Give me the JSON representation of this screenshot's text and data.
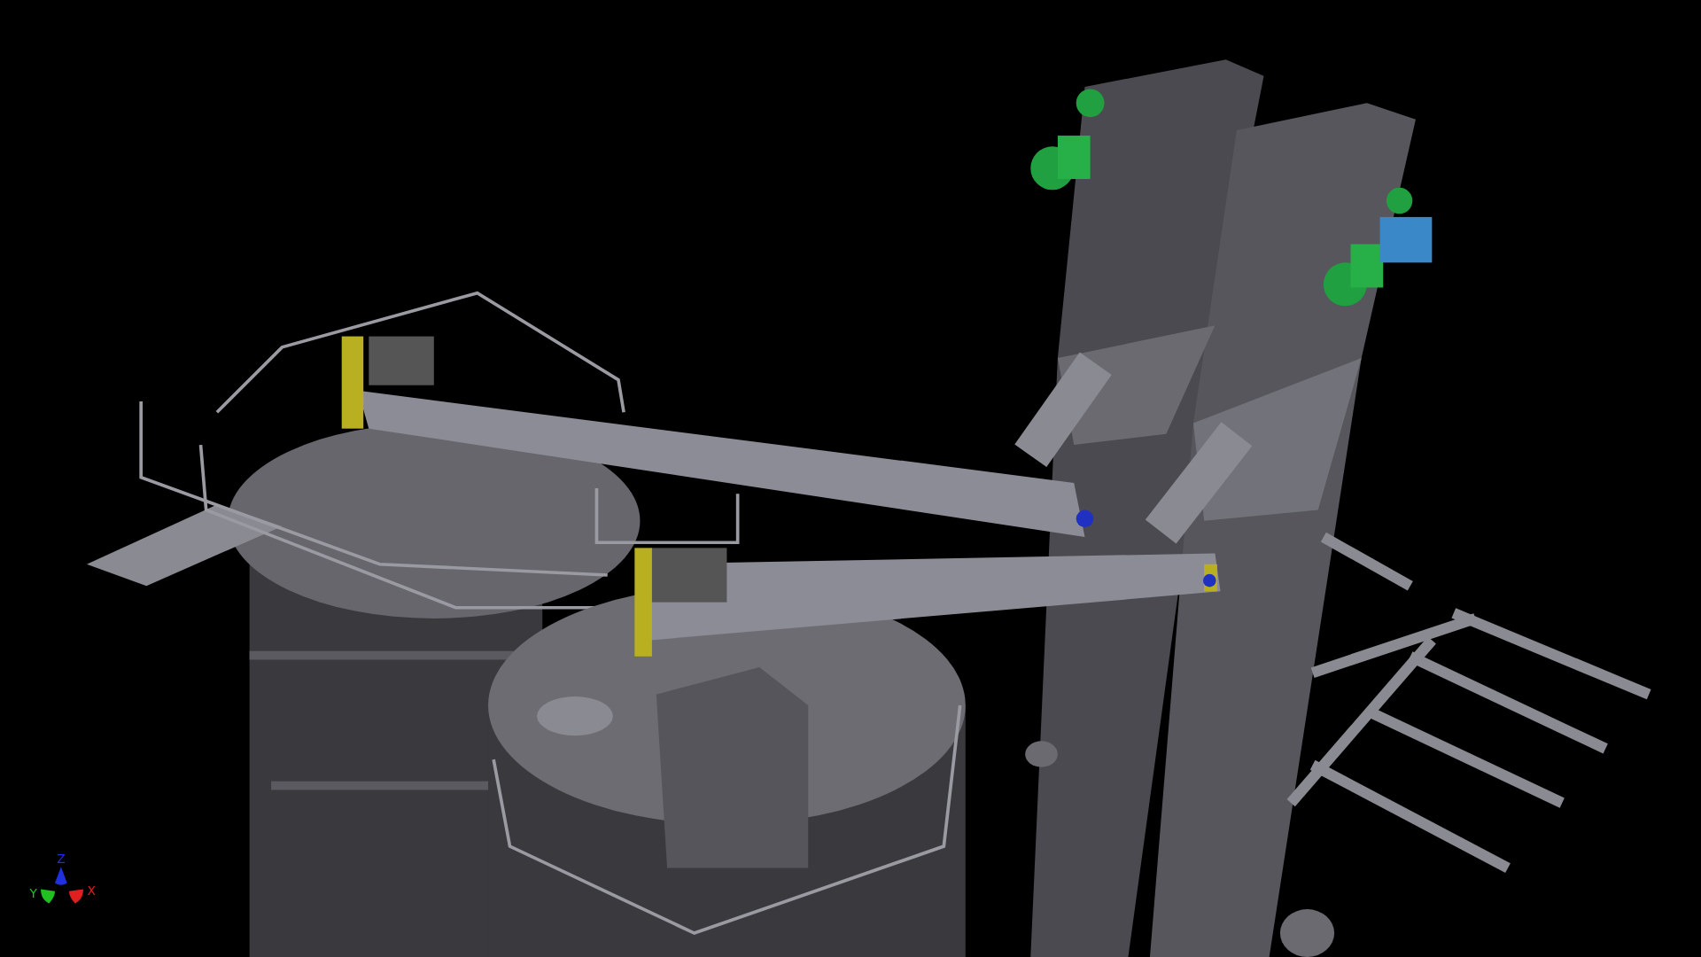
{
  "viewport": {
    "axis_triad": [
      {
        "label": "Z",
        "color": "#2030e0"
      },
      {
        "label": "Y",
        "color": "#20c020"
      },
      {
        "label": "X",
        "color": "#e02020"
      }
    ]
  }
}
